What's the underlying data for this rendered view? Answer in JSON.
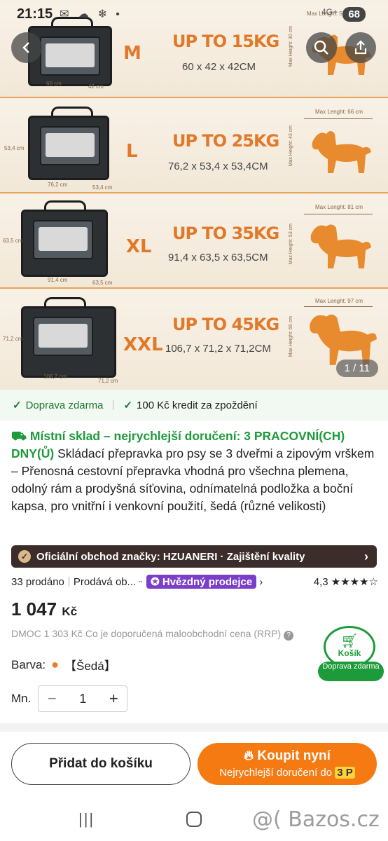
{
  "status": {
    "time": "21:15",
    "icons": "✉ ☁ ❄ •",
    "battery": "68",
    "net": "4G+"
  },
  "gallery": {
    "counter": "1 / 11",
    "panels": [
      {
        "size": "M",
        "weight": "UP TO 15KG",
        "dims": "60 x 42 x 42CM",
        "crate_w": "60 cm",
        "crate_d": "42 cm",
        "crate_h": "",
        "max_h": "Max Height: 30 cm",
        "max_l": "Max Lenght: 56"
      },
      {
        "size": "L",
        "weight": "UP TO 25KG",
        "dims": "76,2 x 53,4 x 53,4CM",
        "crate_w": "76,2 cm",
        "crate_d": "53,4 cm",
        "crate_h": "53,4 cm",
        "max_h": "Max Height: 43 cm",
        "max_l": "Max Lenght: 66 cm"
      },
      {
        "size": "XL",
        "weight": "UP TO 35KG",
        "dims": "91,4 x 63,5 x 63,5CM",
        "crate_w": "91,4 cm",
        "crate_d": "63,5 cm",
        "crate_h": "63,5 cm",
        "max_h": "Max Height: 53 cm",
        "max_l": "Max Lenght: 81 cm"
      },
      {
        "size": "XXL",
        "weight": "UP TO 45KG",
        "dims": "106,7 x 71,2 x 71,2CM",
        "crate_w": "106,7 cm",
        "crate_d": "71,2 cm",
        "crate_h": "71,2 cm",
        "max_h": "Max Height: 66 cm",
        "max_l": "Max Lenght: 97 cm"
      }
    ]
  },
  "strip": {
    "free_shipping": "Doprava zdarma",
    "credit": "100 Kč kredit za zpoždění"
  },
  "product": {
    "delivery_prefix": "Místní sklad – nejrychlejší doručení: 3 PRACOVNÍ(CH) DNY(Ů)",
    "title": " Skládací přepravka pro psy se 3 dveřmi a zipovým vrškem – Přenosná cestovní přepravka vhodná pro všechna plemena, odolný rám a prodyšná síťovina, odnímatelná podložka a boční kapsa, pro vnitřní i venkovní použití, šedá (různé velikosti)"
  },
  "brand_bar": {
    "text": "Oficiální obchod značky: HZUANERI · Zajištění kvality"
  },
  "stats": {
    "sold": "33 prodáno",
    "seller": "Prodává ob...",
    "star_seller": "Hvězdný prodejce",
    "rating": "4,3",
    "stars": "★★★★☆"
  },
  "price": {
    "amount": "1 047",
    "currency": "Kč",
    "rrp": "DMOC 1 303 Kč Co je doporučená maloobchodní cena (RRP)"
  },
  "options": {
    "color_label": "Barva:",
    "color_value": "【Šedá】",
    "qty_label": "Mn.",
    "qty_value": "1"
  },
  "cart_float": {
    "label": "Košík",
    "sub": "Doprava zdarma"
  },
  "actions": {
    "add_to_cart": "Přidat do košíku",
    "buy_now": "Koupit nyní",
    "buy_sub": "Nejrychlejší doručení do",
    "buy_hl": "3 P"
  },
  "watermark": "@( Bazos.cz",
  "colors": {
    "accent_orange": "#f57a12",
    "green": "#1d9a3a",
    "purple": "#7b3ec8",
    "brand_bar": "#3b2d2a"
  }
}
